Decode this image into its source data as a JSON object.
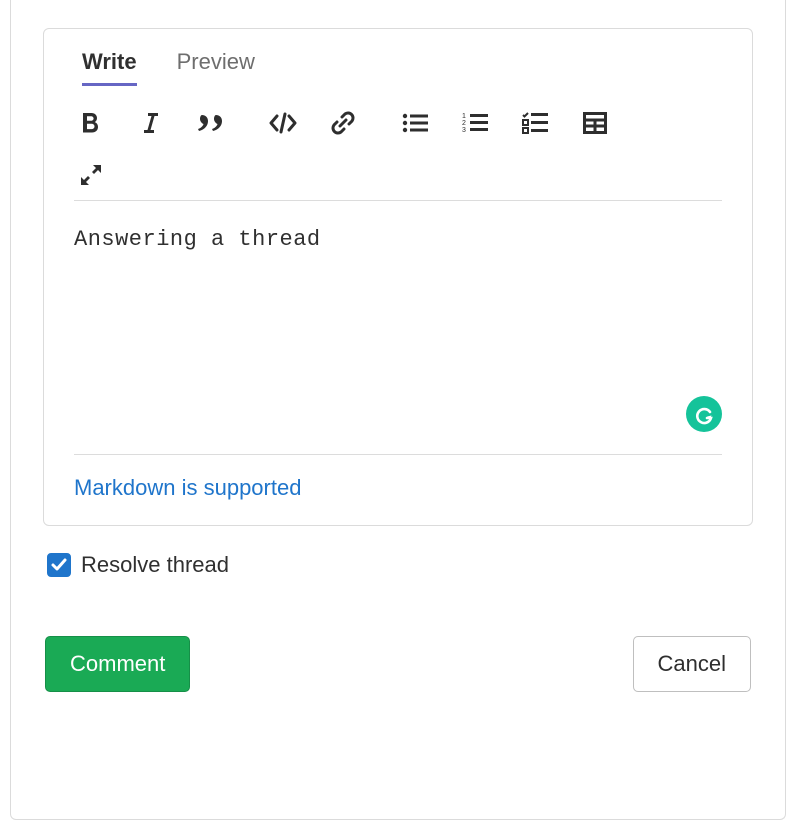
{
  "tabs": {
    "write": "Write",
    "preview": "Preview"
  },
  "editor": {
    "content": "Answering a thread",
    "placeholder": ""
  },
  "markdown_link": "Markdown is supported",
  "resolve": {
    "label": "Resolve thread",
    "checked": true
  },
  "buttons": {
    "comment": "Comment",
    "cancel": "Cancel"
  }
}
